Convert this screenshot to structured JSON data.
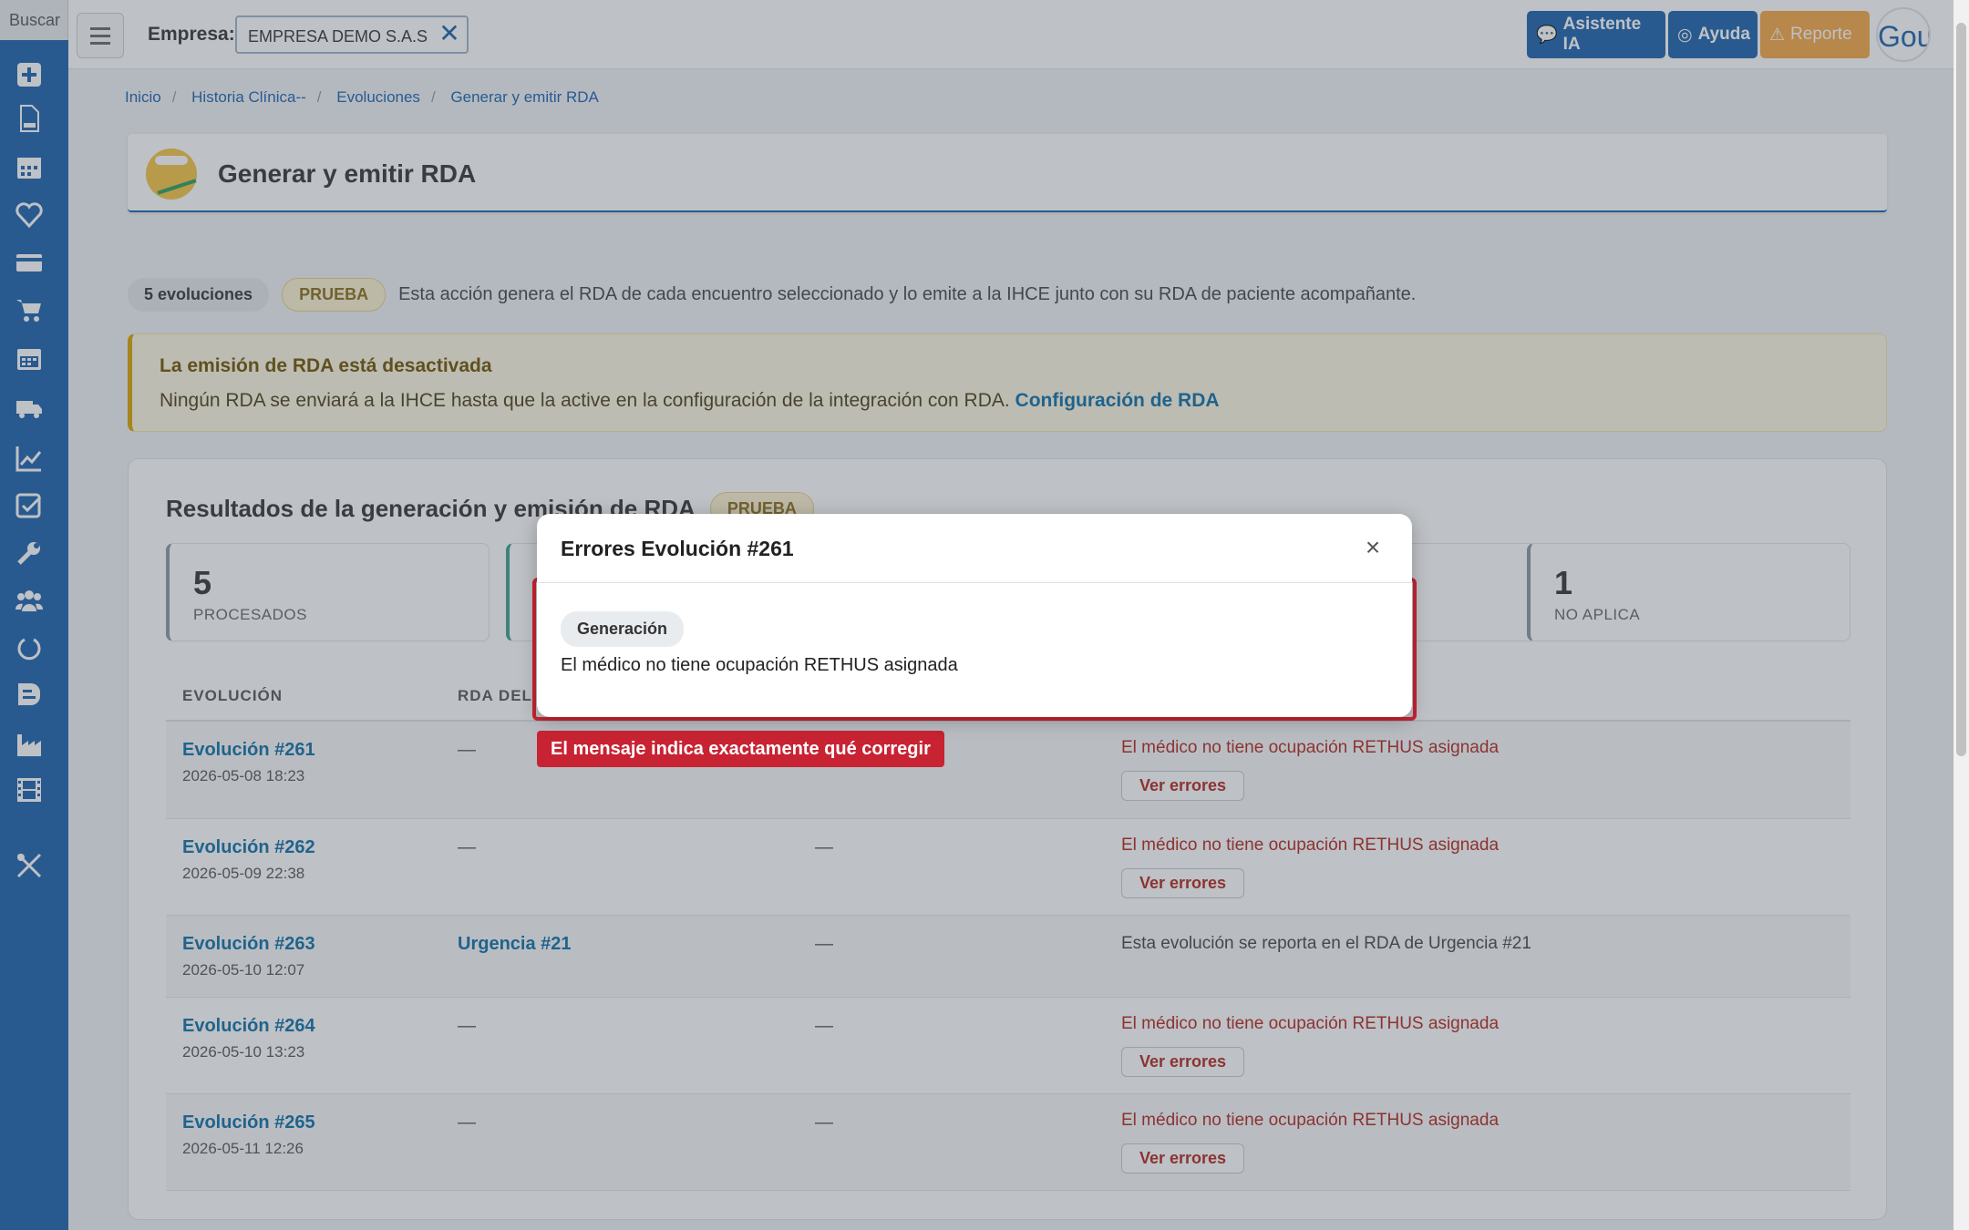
{
  "sidebar": {
    "search_placeholder": "Buscar"
  },
  "topbar": {
    "empresa_label": "Empresa:",
    "empresa_value": "EMPRESA DEMO S.A.S",
    "asistente_label": "Asistente IA",
    "ayuda_label": "Ayuda",
    "reporte_label": "Reporte",
    "user_initials": "Gou"
  },
  "breadcrumb": [
    "Inicio",
    "Historia Clínica--",
    "Evoluciones",
    "Generar y emitir RDA"
  ],
  "page": {
    "title": "Generar y emitir RDA"
  },
  "info": {
    "count_badge": "5 evoluciones",
    "env_badge": "PRUEBA",
    "description": "Esta acción genera el RDA de cada encuentro seleccionado y lo emite a la IHCE junto con su RDA de paciente acompañante."
  },
  "warning": {
    "title": "La emisión de RDA está desactivada",
    "text": "Ningún RDA se enviará a la IHCE hasta que la active en la configuración de la integración con RDA.",
    "link": "Configuración de RDA"
  },
  "results": {
    "title": "Resultados de la generación y emisión de RDA",
    "badge": "PRUEBA",
    "stats": [
      {
        "num": "5",
        "label": "PROCESADOS"
      },
      {
        "num": "1",
        "label": "NO APLICA"
      }
    ],
    "columns": {
      "evolucion": "EVOLUCIÓN",
      "rda": "RDA DEL"
    },
    "rows": [
      {
        "evo": "Evolución #261",
        "date": "2026-05-08 18:23",
        "rda": "—",
        "col3": "",
        "msg": "El médico no tiene ocupación RETHUS asignada",
        "btn": "Ver errores"
      },
      {
        "evo": "Evolución #262",
        "date": "2026-05-09 22:38",
        "rda": "—",
        "col3": "—",
        "msg": "El médico no tiene ocupación RETHUS asignada",
        "btn": "Ver errores"
      },
      {
        "evo": "Evolución #263",
        "date": "2026-05-10 12:07",
        "rda": "Urgencia #21",
        "col3": "—",
        "msg": "Esta evolución se reporta en el RDA de Urgencia #21",
        "btn": ""
      },
      {
        "evo": "Evolución #264",
        "date": "2026-05-10 13:23",
        "rda": "—",
        "col3": "—",
        "msg": "El médico no tiene ocupación RETHUS asignada",
        "btn": "Ver errores"
      },
      {
        "evo": "Evolución #265",
        "date": "2026-05-11 12:26",
        "rda": "—",
        "col3": "—",
        "msg": "El médico no tiene ocupación RETHUS asignada",
        "btn": "Ver errores"
      }
    ]
  },
  "highlight": {
    "label": "El mensaje indica exactamente qué corregir"
  },
  "modal": {
    "title": "Errores Evolución #261",
    "close": "×",
    "pill": "Generación",
    "message": "El médico no tiene ocupación RETHUS asignada"
  },
  "colors": {
    "brand": "#1a62ae",
    "error": "#b3261e",
    "highlight": "#c82333",
    "warning_bg": "#fef8e2"
  },
  "icons": [
    "plus-square-icon",
    "file-rips-icon",
    "calendar-icon",
    "heart-icon",
    "credit-card-icon",
    "cart-icon",
    "calendar-alt-icon",
    "truck-icon",
    "chart-line-icon",
    "check-square-icon",
    "wrench-icon",
    "users-icon",
    "circle-notch-icon",
    "blog-icon",
    "industry-icon",
    "film-icon",
    "tools-icon"
  ]
}
